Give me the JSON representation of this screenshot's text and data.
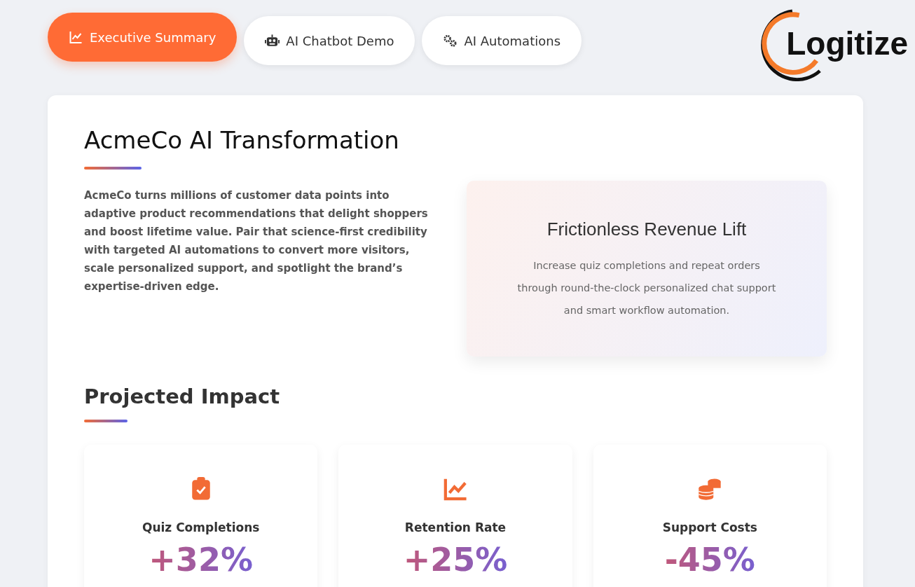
{
  "tabs": [
    {
      "label": "Executive Summary",
      "selected": true
    },
    {
      "label": "AI Chatbot Demo",
      "selected": false
    },
    {
      "label": "AI Automations",
      "selected": false
    }
  ],
  "logo": {
    "text": "Logitize"
  },
  "overview": {
    "title": "AcmeCo AI Transformation",
    "body": "AcmeCo turns millions of customer data points into adaptive product recommendations that delight shoppers and boost lifetime value. Pair that science-first credibility with targeted AI automations to convert more visitors, scale personalized support, and spotlight the brand’s expertise-driven edge."
  },
  "highlight": {
    "title": "Frictionless Revenue Lift",
    "body": "Increase quiz completions and repeat orders through round-the-clock personalized chat support and smart workflow automation."
  },
  "impact": {
    "title": "Projected Impact",
    "metrics": [
      {
        "label": "Quiz Completions",
        "value": "+32%"
      },
      {
        "label": "Retention Rate",
        "value": "+25%"
      },
      {
        "label": "Support Costs",
        "value": "-45%"
      }
    ]
  }
}
